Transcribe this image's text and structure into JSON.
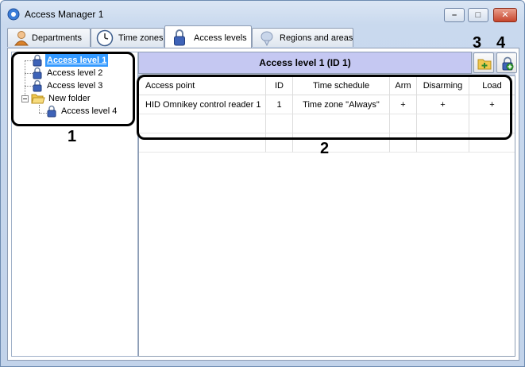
{
  "window": {
    "title": "Access Manager 1"
  },
  "tabs": [
    {
      "label": "Departments",
      "icon": "person-icon"
    },
    {
      "label": "Time zones",
      "icon": "clock-icon"
    },
    {
      "label": "Access levels",
      "icon": "padlock-icon",
      "active": true
    },
    {
      "label": "Regions and areas",
      "icon": "regions-icon"
    }
  ],
  "tree": {
    "items": [
      {
        "label": "Access level 1",
        "selected": true
      },
      {
        "label": "Access level 2"
      },
      {
        "label": "Access level 3"
      },
      {
        "label": "New folder",
        "type": "folder",
        "expanded": true
      },
      {
        "label": "Access level 4"
      }
    ]
  },
  "panel": {
    "header": "Access level 1 (ID 1)",
    "toolbar": {
      "add_icon": "folder-add-icon",
      "lock_icon": "access-level-add-icon"
    }
  },
  "grid": {
    "columns": [
      "Access point",
      "ID",
      "Time schedule",
      "Arm",
      "Disarming",
      "Load"
    ],
    "rows": [
      [
        "HID Omnikey control reader 1",
        "1",
        "Time zone \"Always\"",
        "+",
        "+",
        "+"
      ]
    ]
  },
  "callouts": [
    "1",
    "2",
    "3",
    "4"
  ]
}
